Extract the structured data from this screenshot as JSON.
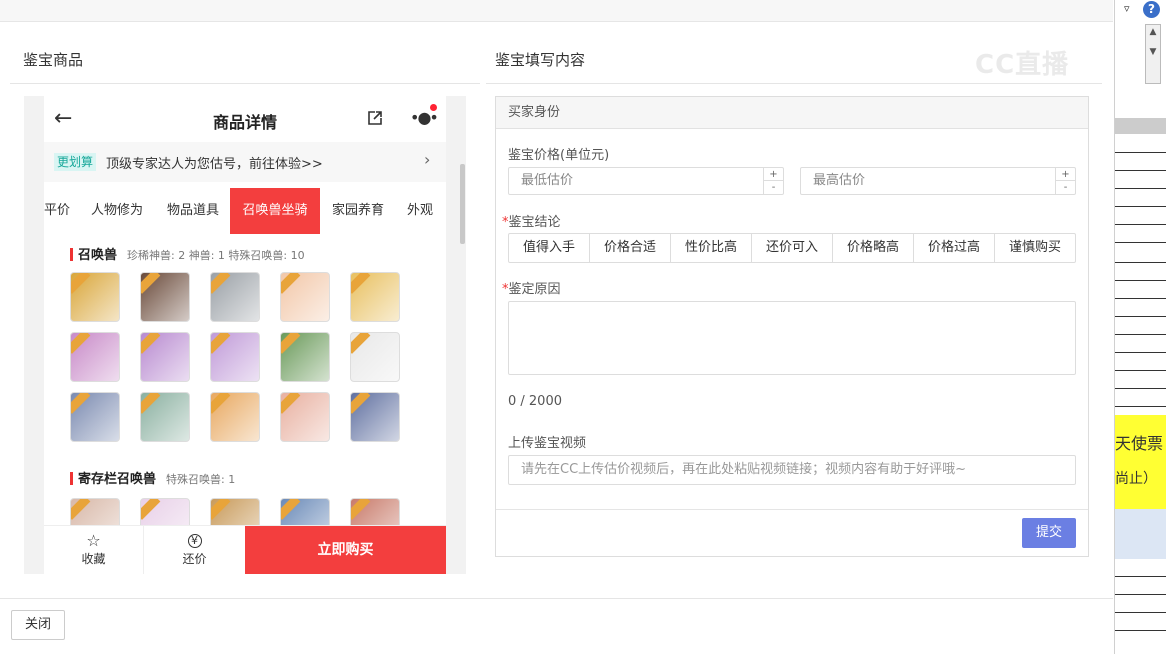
{
  "left_panel": {
    "title": "鉴宝商品"
  },
  "right_panel": {
    "title": "鉴宝填写内容"
  },
  "watermark": "CC直播",
  "phone": {
    "header_title": "商品详情",
    "promo": {
      "tag": "更划算",
      "text": "顶级专家达人为您估号，前往体验>>"
    },
    "tabs": [
      "平价",
      "人物修为",
      "物品道具",
      "召唤兽坐骑",
      "家园养育",
      "外观"
    ],
    "active_tab": "召唤兽坐骑",
    "section1": {
      "title": "召唤兽",
      "stats": "珍稀神兽: 2   神兽: 1   特殊召唤兽: 10"
    },
    "section2": {
      "title": "寄存栏召唤兽",
      "stats": "特殊召唤兽: 1"
    },
    "bottom": {
      "favorite": "收藏",
      "bargain": "还价",
      "bargain_icon": "¥",
      "buy": "立即购买"
    },
    "avatar_colors": [
      "#d9a63a",
      "#6a4a3a",
      "#9aa0a6",
      "#f2c7a8",
      "#e8c060",
      "#c88ac8",
      "#b88ad0",
      "#c09ad8",
      "#6a9a5a",
      "#e8e8e8",
      "#7a8ab0",
      "#8ab0a0",
      "#e8a860",
      "#e8b0a0",
      "#6070a0"
    ],
    "avatar_colors_row4": [
      "#d8b8a8",
      "#e8d0e8",
      "#c89a5a",
      "#6a8ab8",
      "#c87a6a"
    ]
  },
  "form": {
    "section_title": "买家身份",
    "price_label": "鉴宝价格(单位元)",
    "min_placeholder": "最低估价",
    "max_placeholder": "最高估价",
    "conclusion_label": "鉴宝结论",
    "conclusions": [
      "值得入手",
      "价格合适",
      "性价比高",
      "还价可入",
      "价格略高",
      "价格过高",
      "谨慎购买"
    ],
    "reason_label": "鉴定原因",
    "counter": "0 / 2000",
    "video_label": "上传鉴宝视频",
    "video_placeholder": "请先在CC上传估价视频后，再在此处粘贴视频链接；视频内容有助于好评哦~",
    "submit": "提交"
  },
  "close_button": "关闭",
  "excel_strip": {
    "text1": "天使票",
    "text2": "尚止）"
  }
}
